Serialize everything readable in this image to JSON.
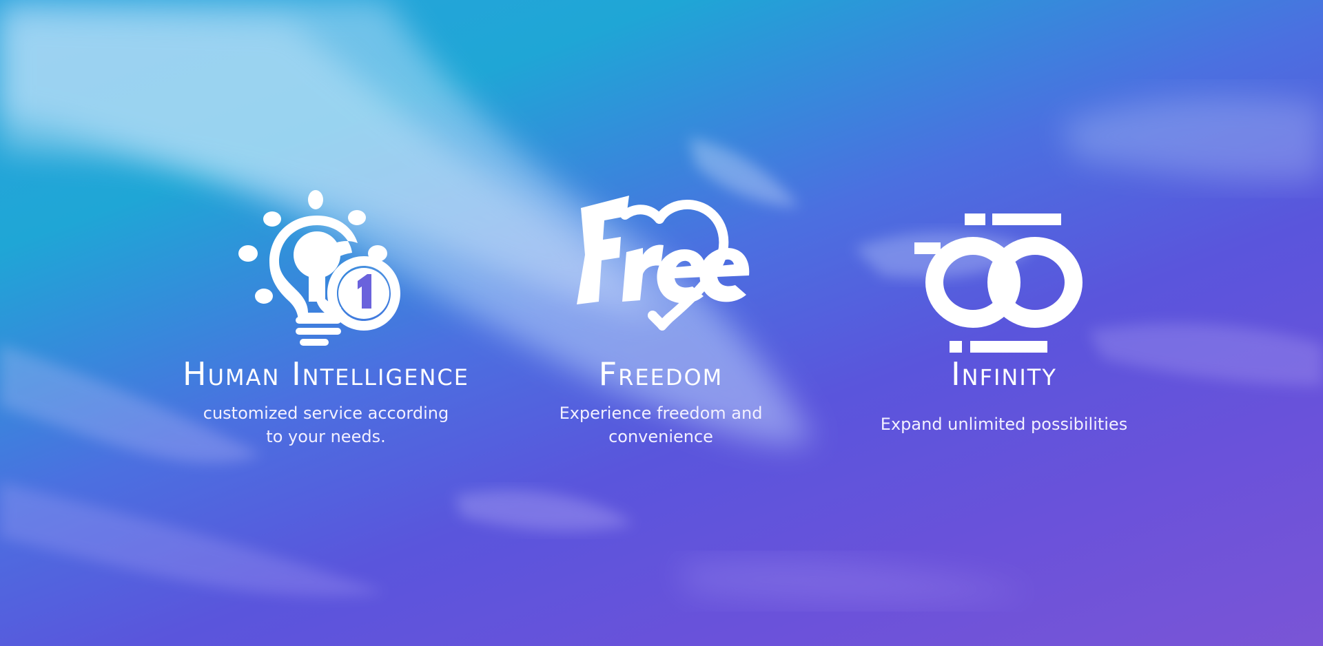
{
  "colors": {
    "sky_top": "#1fa6d6",
    "sky_bottom": "#6a52da",
    "text": "#ffffff"
  },
  "features": [
    {
      "icon": "lightbulb-number-one-icon",
      "title": "Human Intelligence",
      "description": "customized service according to your needs."
    },
    {
      "icon": "free-heart-icon",
      "title": "Freedom",
      "description": "Experience freedom and convenience"
    },
    {
      "icon": "infinity-icon",
      "title": "Infinity",
      "description": "Expand unlimited possibilities"
    }
  ]
}
